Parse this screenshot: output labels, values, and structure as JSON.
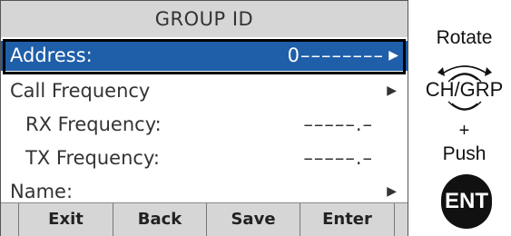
{
  "screen": {
    "title": "GROUP ID",
    "menu": [
      {
        "label": "Address:",
        "value": "0––––––––",
        "arrow": "▶"
      },
      {
        "label": "Call Frequency",
        "value": "",
        "arrow": "▶"
      },
      {
        "label": "RX Frequency:",
        "value": "–––––.–",
        "arrow": ""
      },
      {
        "label": "TX Frequency:",
        "value": "–––––.–",
        "arrow": ""
      },
      {
        "label": "Name:",
        "value": "",
        "arrow": "▶"
      }
    ],
    "softkeys": [
      "Exit",
      "Back",
      "Save",
      "Enter"
    ],
    "colors": {
      "selection": "#1f5ea8",
      "bar": "#d6d6d6"
    }
  },
  "controls": {
    "rotate_label": "Rotate",
    "dial_label": "CH/GRP",
    "plus_label": "+",
    "push_label": "Push",
    "ent_label": "ENT"
  }
}
